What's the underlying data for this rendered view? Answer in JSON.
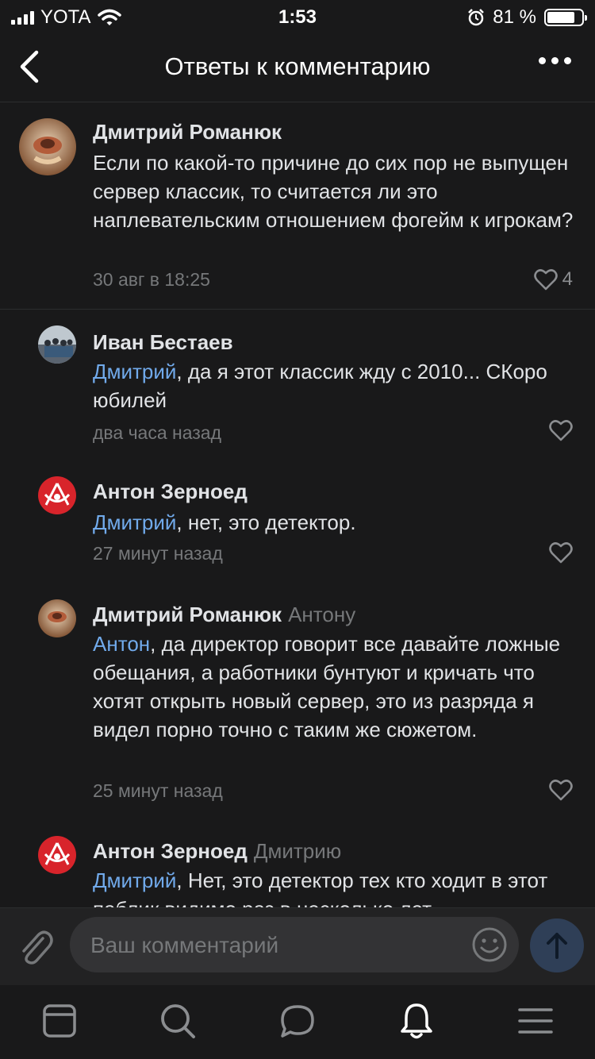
{
  "status_bar": {
    "carrier": "YOTA",
    "time": "1:53",
    "battery": "81 %",
    "battery_level": 0.81
  },
  "header": {
    "title": "Ответы к комментарию",
    "back_icon": "chevron-left-icon",
    "more_icon": "more-horizontal-icon"
  },
  "root_comment": {
    "author": "Дмитрий Романюк",
    "text": "Если по какой-то причине до сих пор не выпущен сервер классик, то считается ли это наплевательским отношением  фогейм к игрокам?",
    "date": "30 авг в 18:25",
    "likes": "4"
  },
  "replies": [
    {
      "author": "Иван Бестаев",
      "to": "",
      "mention": "Дмитрий",
      "text": ", да я этот классик жду с  2010... СКоро юбилей",
      "date": "два часа назад"
    },
    {
      "author": "Антон Зерноед",
      "to": "",
      "mention": "Дмитрий",
      "text": ", нет, это детектор.",
      "date": "27 минут назад"
    },
    {
      "author": "Дмитрий Романюк",
      "to": "Антону",
      "mention": "Антон",
      "text": ", да директор говорит все давайте ложные обещания, а работники бунтуют и кричать что хотят открыть новый сервер, это из разряда я видел порно точно с таким же сюжетом.",
      "date": "25 минут назад"
    },
    {
      "author": "Антон Зерноед",
      "to": "Дмитрию",
      "mention": "Дмитрий",
      "text": ", Нет, это детектор тех кто ходит в этот паблик видимо раз в несколько лет",
      "date": ""
    }
  ],
  "composer": {
    "placeholder": "Ваш комментарий"
  },
  "tab_bar": {
    "items": [
      "feed-icon",
      "search-icon",
      "messages-icon",
      "notifications-icon",
      "menu-icon"
    ],
    "active": "notifications-icon"
  },
  "colors": {
    "background": "#19191a",
    "link": "#71aaeb",
    "secondary": "#76787a",
    "send_button": "#2f3f57"
  }
}
